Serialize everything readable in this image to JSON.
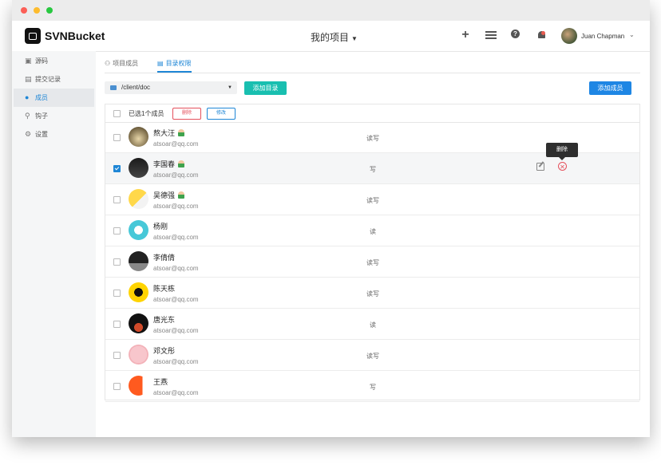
{
  "app": {
    "brand": "SVNBucket"
  },
  "header": {
    "project_label": "我的项目",
    "user_name": "Juan Chapman",
    "icons": [
      "plus-icon",
      "list-icon",
      "help-icon",
      "bell-icon"
    ]
  },
  "sidebar": {
    "items": [
      {
        "label": "源码",
        "icon": "code-icon",
        "active": false
      },
      {
        "label": "提交记录",
        "icon": "commit-icon",
        "active": false
      },
      {
        "label": "成员",
        "icon": "members-icon",
        "active": true
      },
      {
        "label": "钩子",
        "icon": "hook-icon",
        "active": false
      },
      {
        "label": "设置",
        "icon": "settings-icon",
        "active": false
      }
    ]
  },
  "tabs": [
    {
      "label": "项目成员",
      "active": false
    },
    {
      "label": "目录权限",
      "active": true
    }
  ],
  "toolbar": {
    "path": "/client/doc",
    "add_dir_label": "添加目录",
    "add_member_label": "添加成员"
  },
  "table": {
    "selected_text": "已选1个成员",
    "delete_label": "删除",
    "modify_label": "修改",
    "tooltip": "删除",
    "rows": [
      {
        "name": "熬大汪",
        "email": "atsoar@qq.com",
        "perm": "读写",
        "checked": false,
        "badge": true
      },
      {
        "name": "李国春",
        "email": "atsoar@qq.com",
        "perm": "写",
        "checked": true,
        "badge": true
      },
      {
        "name": "吴德强",
        "email": "atsoar@qq.com",
        "perm": "读写",
        "checked": false,
        "badge": true
      },
      {
        "name": "杨刚",
        "email": "atsoar@qq.com",
        "perm": "读",
        "checked": false,
        "badge": false
      },
      {
        "name": "李倩倩",
        "email": "atsoar@qq.com",
        "perm": "读写",
        "checked": false,
        "badge": false
      },
      {
        "name": "陈天栋",
        "email": "atsoar@qq.com",
        "perm": "读写",
        "checked": false,
        "badge": false
      },
      {
        "name": "唐光东",
        "email": "atsoar@qq.com",
        "perm": "读",
        "checked": false,
        "badge": false
      },
      {
        "name": "邓文彤",
        "email": "atsoar@qq.com",
        "perm": "读写",
        "checked": false,
        "badge": false
      },
      {
        "name": "王燕",
        "email": "atsoar@qq.com",
        "perm": "写",
        "checked": false,
        "badge": false
      }
    ]
  },
  "colors": {
    "accent": "#1e86d6",
    "teal": "#19bfb0",
    "danger": "#e5505c"
  }
}
